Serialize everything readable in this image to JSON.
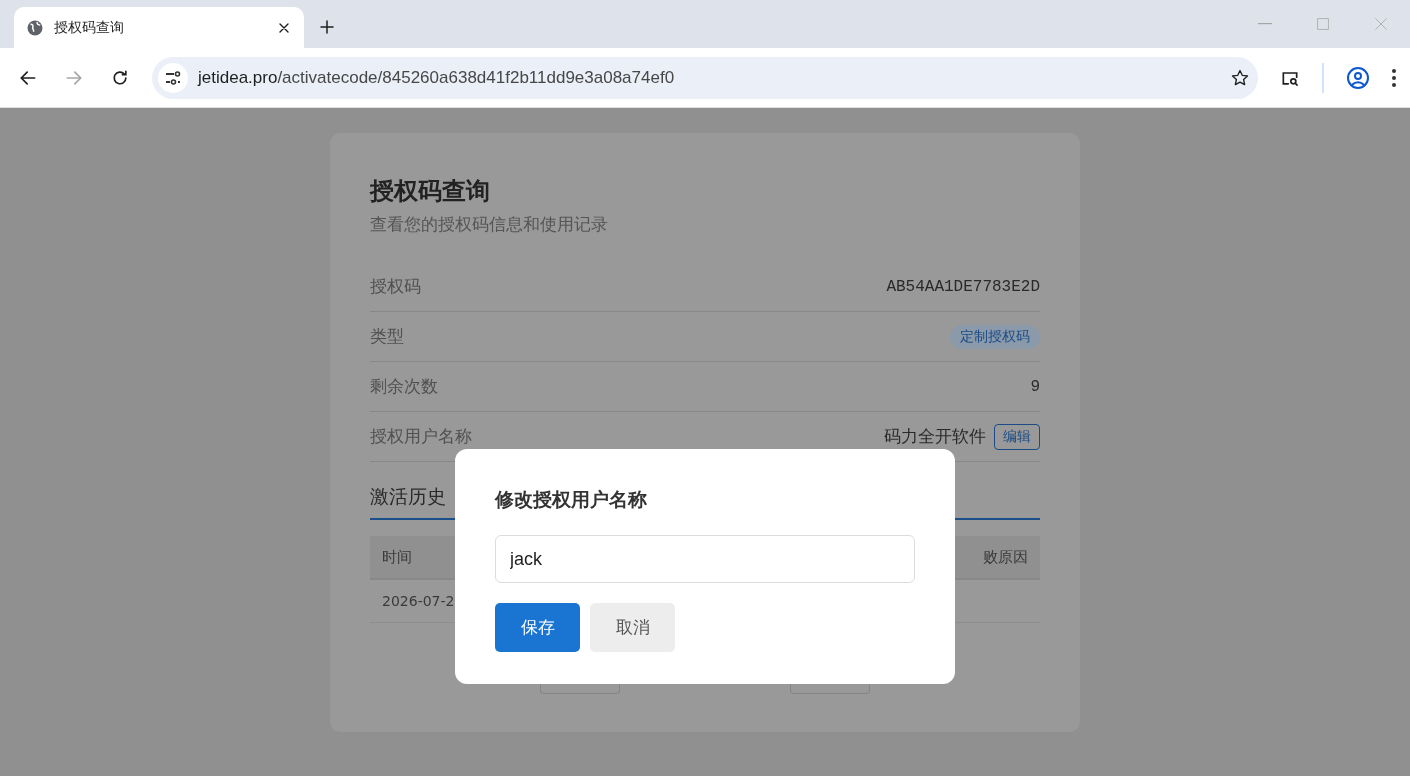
{
  "browser": {
    "tab": {
      "title": "授权码查询"
    },
    "address": {
      "host": "jetidea.pro",
      "path": "/activatecode/845260a638d41f2b11dd9e3a08a74ef0"
    },
    "forward_disabled": true
  },
  "card": {
    "title": "授权码查询",
    "subtitle": "查看您的授权码信息和使用记录",
    "fields": [
      {
        "kind": "mono",
        "label": "授权码",
        "value": "AB54AA1DE7783E2D"
      },
      {
        "kind": "badge",
        "label": "类型",
        "value": "定制授权码"
      },
      {
        "kind": "mono",
        "label": "剩余次数",
        "value": "9"
      },
      {
        "kind": "editable",
        "label": "授权用户名称",
        "value": "码力全开软件",
        "action": "编辑"
      }
    ],
    "history": {
      "title": "激活历史",
      "columns": [
        "时间",
        "败原因"
      ],
      "rows": [
        [
          "2026-07-2"
        ]
      ]
    }
  },
  "dialog": {
    "title": "修改授权用户名称",
    "input": {
      "value": "jack"
    },
    "buttons": [
      {
        "label": "保存",
        "kind": "primary"
      },
      {
        "label": "取消",
        "kind": "secondary"
      }
    ]
  }
}
